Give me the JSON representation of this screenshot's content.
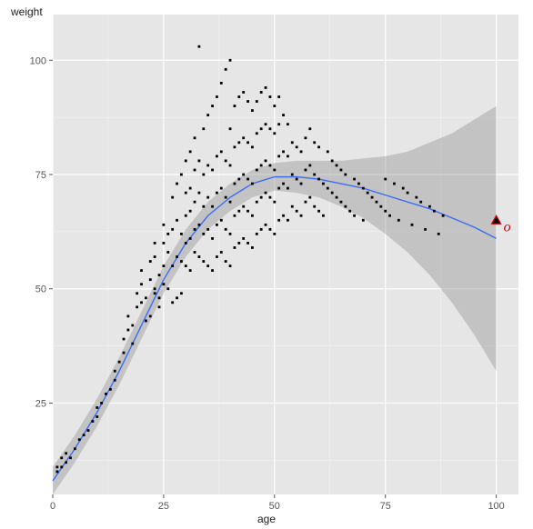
{
  "chart_data": {
    "type": "scatter",
    "title": "",
    "xlabel": "age",
    "ylabel": "weight",
    "xlim": [
      0,
      105
    ],
    "ylim": [
      5,
      110
    ],
    "x_ticks": [
      0,
      25,
      50,
      75,
      100
    ],
    "y_ticks": [
      25,
      50,
      75,
      100
    ],
    "grid": true,
    "series": [
      {
        "name": "points",
        "type": "scatter",
        "x": [
          1,
          1,
          2,
          2,
          3,
          3,
          4,
          5,
          6,
          7,
          8,
          9,
          10,
          10,
          11,
          12,
          13,
          14,
          14,
          15,
          16,
          16,
          17,
          17,
          18,
          18,
          19,
          19,
          20,
          20,
          20,
          21,
          21,
          22,
          22,
          22,
          23,
          23,
          23,
          23,
          24,
          24,
          24,
          25,
          25,
          25,
          25,
          26,
          26,
          26,
          27,
          27,
          27,
          27,
          28,
          28,
          28,
          28,
          29,
          29,
          29,
          29,
          30,
          30,
          30,
          30,
          30,
          31,
          31,
          31,
          31,
          31,
          32,
          32,
          32,
          32,
          32,
          33,
          33,
          33,
          33,
          33,
          34,
          34,
          34,
          34,
          34,
          35,
          35,
          35,
          35,
          35,
          36,
          36,
          36,
          36,
          36,
          37,
          37,
          37,
          37,
          37,
          38,
          38,
          38,
          38,
          38,
          39,
          39,
          39,
          39,
          39,
          40,
          40,
          40,
          40,
          40,
          40,
          41,
          41,
          41,
          41,
          41,
          42,
          42,
          42,
          42,
          42,
          43,
          43,
          43,
          43,
          43,
          44,
          44,
          44,
          44,
          44,
          45,
          45,
          45,
          45,
          45,
          46,
          46,
          46,
          46,
          46,
          47,
          47,
          47,
          47,
          47,
          48,
          48,
          48,
          48,
          48,
          49,
          49,
          49,
          49,
          49,
          50,
          50,
          50,
          50,
          50,
          51,
          51,
          51,
          51,
          51,
          52,
          52,
          52,
          52,
          53,
          53,
          53,
          53,
          54,
          54,
          54,
          55,
          55,
          55,
          56,
          56,
          56,
          57,
          57,
          57,
          58,
          58,
          58,
          59,
          59,
          59,
          60,
          60,
          60,
          61,
          61,
          62,
          62,
          63,
          63,
          64,
          64,
          65,
          65,
          66,
          66,
          67,
          68,
          68,
          69,
          70,
          70,
          71,
          72,
          73,
          74,
          75,
          75,
          76,
          77,
          78,
          79,
          80,
          81,
          82,
          83,
          84,
          85,
          86,
          87,
          88
        ],
        "y": [
          11,
          10,
          11,
          13,
          12,
          14,
          13,
          15,
          17,
          18,
          19,
          21,
          22,
          24,
          25,
          27,
          28,
          30,
          32,
          34,
          36,
          39,
          41,
          44,
          42,
          38,
          46,
          49,
          47,
          51,
          54,
          43,
          48,
          44,
          52,
          56,
          49,
          50,
          57,
          60,
          46,
          53,
          48,
          51,
          55,
          60,
          64,
          50,
          58,
          62,
          47,
          55,
          63,
          70,
          48,
          57,
          65,
          73,
          49,
          56,
          62,
          75,
          55,
          60,
          66,
          71,
          78,
          54,
          61,
          67,
          72,
          80,
          58,
          63,
          69,
          76,
          83,
          103,
          57,
          64,
          71,
          78,
          56,
          62,
          68,
          75,
          85,
          55,
          63,
          70,
          77,
          88,
          54,
          61,
          68,
          76,
          90,
          57,
          64,
          71,
          79,
          92,
          58,
          65,
          72,
          80,
          95,
          56,
          63,
          70,
          78,
          98,
          55,
          62,
          69,
          77,
          85,
          100,
          59,
          66,
          73,
          81,
          90,
          60,
          67,
          74,
          82,
          92,
          61,
          68,
          75,
          83,
          93,
          60,
          67,
          74,
          82,
          91,
          59,
          66,
          73,
          81,
          89,
          62,
          69,
          76,
          84,
          91,
          63,
          70,
          77,
          85,
          93,
          64,
          71,
          78,
          86,
          94,
          63,
          70,
          77,
          85,
          92,
          62,
          69,
          76,
          84,
          90,
          65,
          72,
          79,
          86,
          92,
          66,
          73,
          80,
          88,
          65,
          72,
          79,
          86,
          68,
          75,
          82,
          67,
          74,
          81,
          66,
          73,
          80,
          69,
          76,
          83,
          70,
          77,
          85,
          68,
          75,
          82,
          67,
          74,
          81,
          66,
          73,
          72,
          80,
          71,
          78,
          70,
          77,
          69,
          76,
          68,
          75,
          67,
          66,
          74,
          73,
          65,
          72,
          71,
          70,
          69,
          68,
          67,
          74,
          66,
          73,
          65,
          72,
          71,
          64,
          70,
          69,
          63,
          68,
          67,
          62,
          66
        ],
        "color": "#000000"
      },
      {
        "name": "smooth",
        "type": "line",
        "x": [
          0,
          5,
          10,
          15,
          20,
          25,
          30,
          35,
          40,
          45,
          50,
          55,
          60,
          65,
          70,
          75,
          80,
          85,
          90,
          95,
          100
        ],
        "y": [
          8,
          15,
          23,
          32,
          42,
          52,
          60,
          66,
          70,
          73,
          74.5,
          74.5,
          74,
          73,
          72,
          70.5,
          69,
          67.5,
          65.5,
          63.5,
          61
        ],
        "color": "#3b6cf6"
      },
      {
        "name": "ci_lower",
        "type": "ribbon_low",
        "x": [
          0,
          5,
          10,
          15,
          20,
          25,
          30,
          35,
          40,
          45,
          50,
          55,
          60,
          65,
          70,
          75,
          80,
          85,
          90,
          95,
          100
        ],
        "y": [
          5,
          12,
          20,
          29,
          39,
          49,
          57,
          63,
          67,
          70,
          71.5,
          71,
          70,
          68,
          65.5,
          62,
          58,
          53,
          47,
          40,
          32
        ]
      },
      {
        "name": "ci_upper",
        "type": "ribbon_high",
        "x": [
          0,
          5,
          10,
          15,
          20,
          25,
          30,
          35,
          40,
          45,
          50,
          55,
          60,
          65,
          70,
          75,
          80,
          85,
          90,
          95,
          100
        ],
        "y": [
          11,
          18,
          26,
          35,
          45,
          55,
          63,
          69,
          73,
          76,
          77.5,
          78,
          78,
          78,
          78.5,
          79,
          80,
          82,
          84,
          87,
          90
        ]
      }
    ],
    "annotations": [
      {
        "name": "outlier",
        "shape": "triangle",
        "x": 100,
        "y": 65,
        "label": "o",
        "label_color": "#cc0000"
      }
    ]
  }
}
